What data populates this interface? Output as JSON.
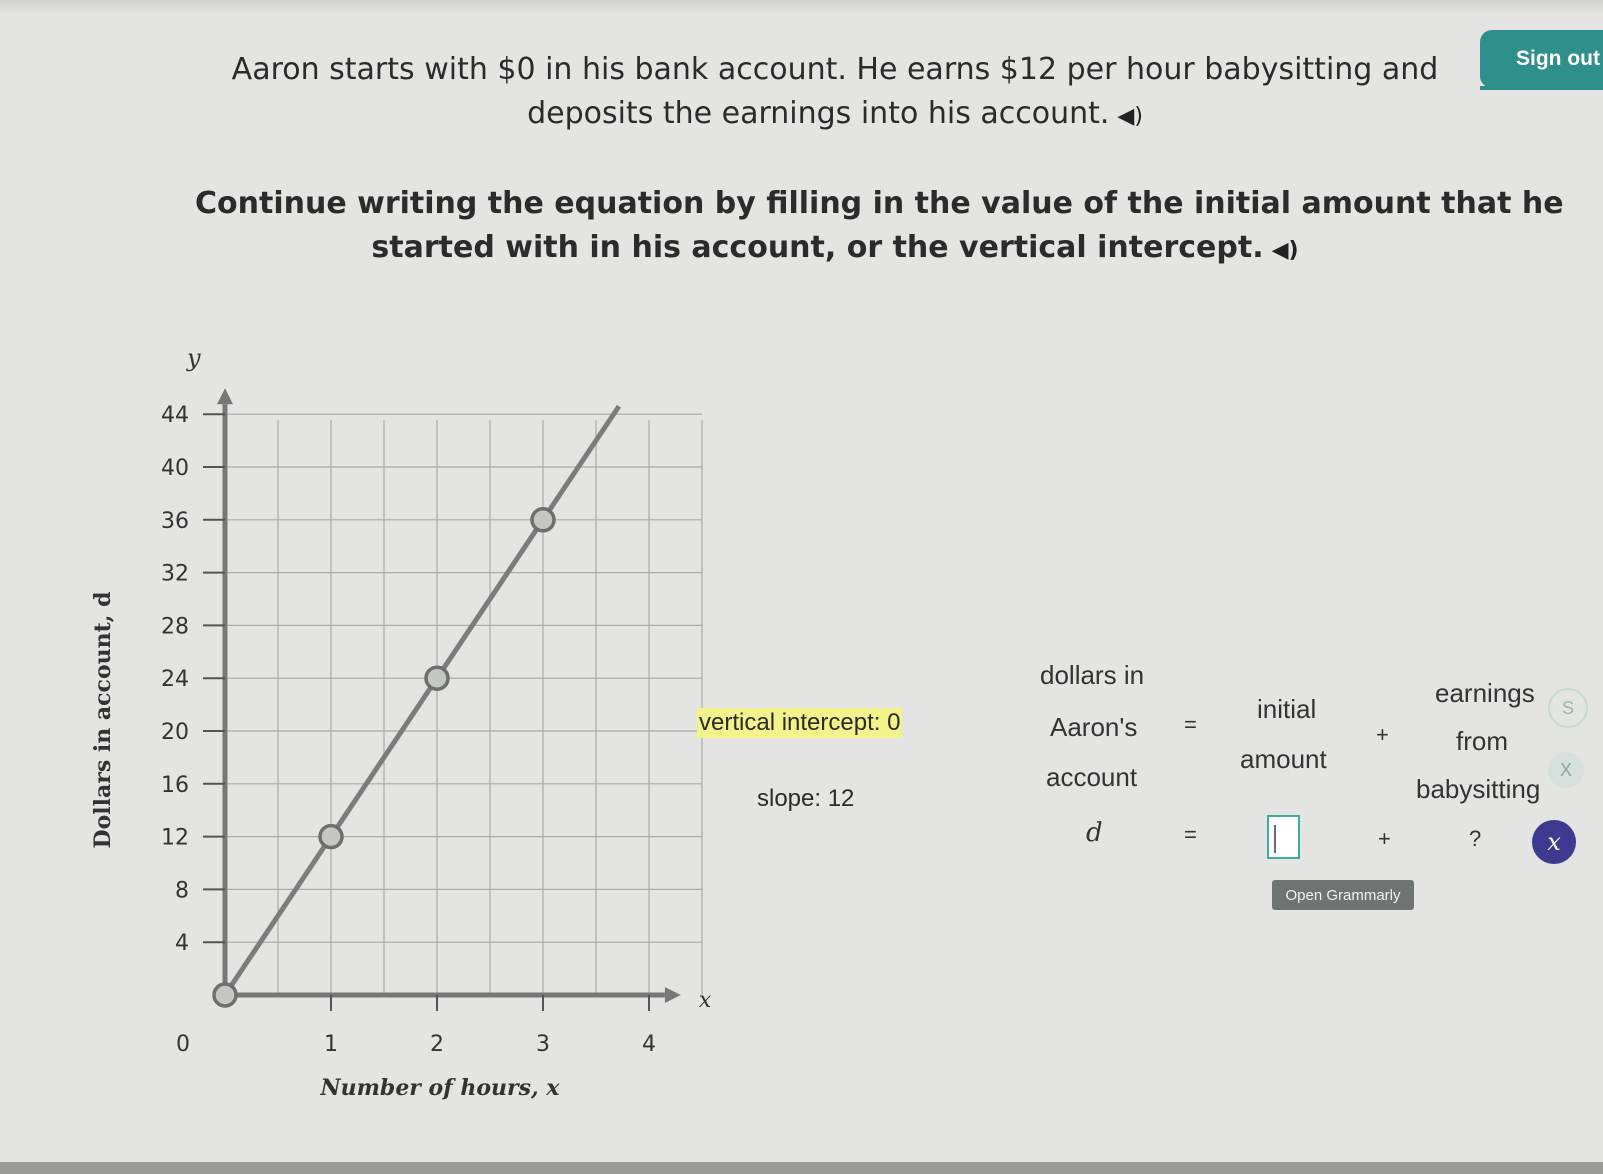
{
  "header": {
    "signout_label": "Sign out"
  },
  "prompt": {
    "intro_line1": "Aaron starts with $0 in his bank account. He earns $12 per hour babysitting and",
    "intro_line2": "deposits the earnings into his account.",
    "instruction_line1": "Continue writing the equation by filling in the value of the initial amount that he",
    "instruction_line2": "started with in his account, or the vertical intercept."
  },
  "icons": {
    "speaker": "speaker-icon",
    "speaker_glyph": "◀)"
  },
  "chart_data": {
    "type": "line",
    "xlabel": "Number of hours, x",
    "ylabel": "Dollars in account, d",
    "x_axis_name": "x",
    "y_axis_name": "y",
    "x_ticks": [
      "0",
      "1",
      "2",
      "3",
      "4"
    ],
    "y_ticks": [
      "4",
      "8",
      "12",
      "16",
      "20",
      "24",
      "28",
      "32",
      "36",
      "40",
      "44"
    ],
    "xlim": [
      0,
      4
    ],
    "ylim": [
      0,
      44
    ],
    "line": {
      "x": [
        0,
        4
      ],
      "y": [
        0,
        48
      ]
    },
    "points": [
      {
        "x": 0,
        "y": 0
      },
      {
        "x": 1,
        "y": 12
      },
      {
        "x": 2,
        "y": 24
      },
      {
        "x": 3,
        "y": 36
      }
    ],
    "grid": true,
    "grid_x_step": 0.5,
    "colors": {
      "line": "#7c7c7c",
      "point_fill": "#c5c7c5",
      "grid": "#a9aaa8"
    }
  },
  "info": {
    "vertical_intercept": "vertical intercept: 0",
    "slope": "slope: 12"
  },
  "equation": {
    "words_left": [
      "dollars in",
      "Aaron's",
      "account"
    ],
    "equals": "=",
    "words_mid": [
      "initial",
      "amount"
    ],
    "plus": "+",
    "words_right": [
      "earnings",
      "from",
      "babysitting"
    ],
    "var_d": "d",
    "answer_value": "",
    "placeholder": "?",
    "grammarly_label": "Open Grammarly"
  },
  "side_buttons": {
    "s_label": "S",
    "x_label": "X",
    "clear_label": "x"
  },
  "colors": {
    "accent": "#2f8f8a",
    "highlight": "#f4f28a",
    "clear_button": "#3e3a8f"
  }
}
